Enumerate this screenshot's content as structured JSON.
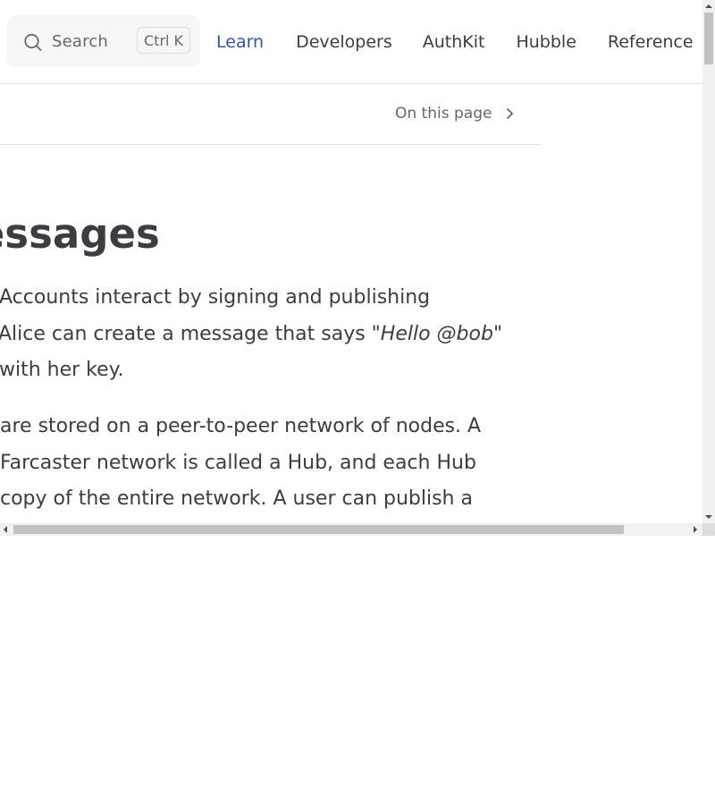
{
  "nav": {
    "search": {
      "label": "Search",
      "shortcut": "Ctrl K",
      "icon": "search-icon"
    },
    "links": [
      {
        "label": "Learn",
        "active": true
      },
      {
        "label": "Developers",
        "active": false
      },
      {
        "label": "AuthKit",
        "active": false
      },
      {
        "label": "Hubble",
        "active": false
      },
      {
        "label": "Reference",
        "active": false
      }
    ],
    "active_color": "#3451b2"
  },
  "local_nav": {
    "outline_label": "On this page",
    "icon": "chevron-right-icon"
  },
  "content": {
    "heading": "Messages",
    "paragraph_1": {
      "line_1": "Accounts interact by signing and publishing",
      "line_2_before": "Alice can create a message that says \"",
      "line_2_em": "Hello @bob",
      "line_2_after": "\"",
      "line_3": "with her key."
    },
    "paragraph_2": {
      "line_1": "are stored on a peer-to-peer network of nodes. A",
      "line_2": "Farcaster network is called a Hub, and each Hub",
      "line_3": "copy of the entire network. A user can publish a"
    }
  }
}
